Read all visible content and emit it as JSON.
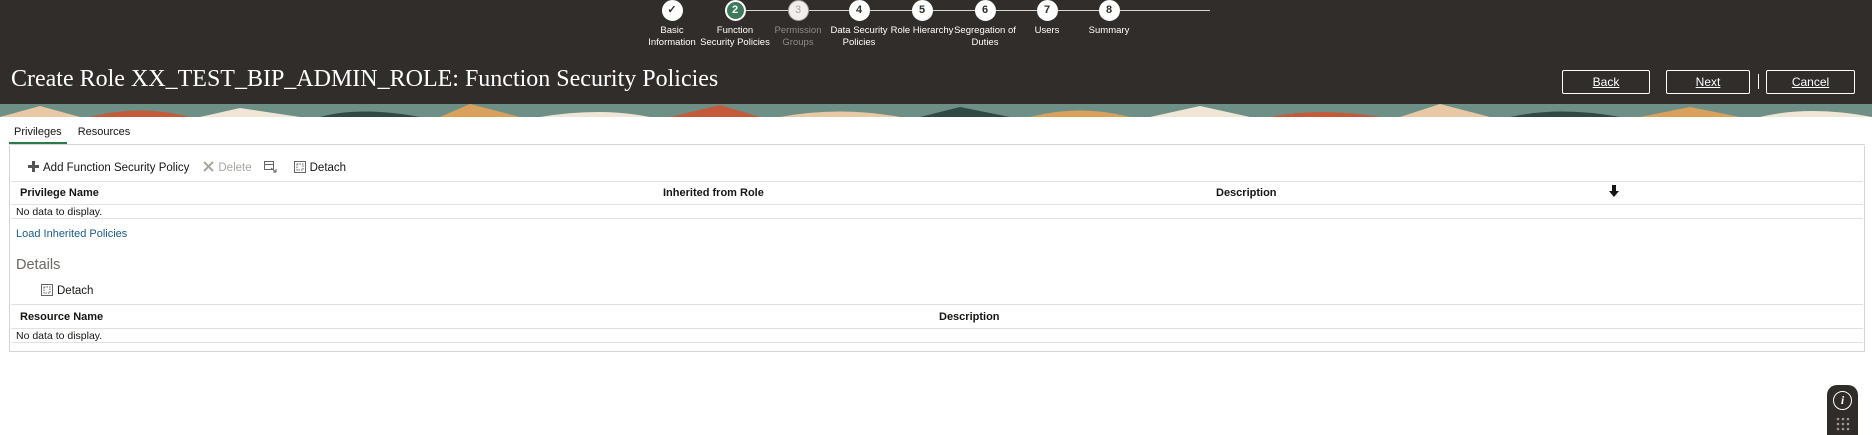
{
  "train": {
    "steps": [
      {
        "number": "✓",
        "label_line1": "Basic",
        "label_line2": "Information",
        "state": "done"
      },
      {
        "number": "2",
        "label_line1": "Function",
        "label_line2": "Security Policies",
        "state": "current"
      },
      {
        "number": "3",
        "label_line1": "Permission",
        "label_line2": "Groups",
        "state": "disabled"
      },
      {
        "number": "4",
        "label_line1": "Data Security",
        "label_line2": "Policies",
        "state": "normal"
      },
      {
        "number": "5",
        "label_line1": "Role Hierarchy",
        "label_line2": "",
        "state": "normal"
      },
      {
        "number": "6",
        "label_line1": "Segregation of",
        "label_line2": "Duties",
        "state": "normal"
      },
      {
        "number": "7",
        "label_line1": "Users",
        "label_line2": "",
        "state": "normal"
      },
      {
        "number": "8",
        "label_line1": "Summary",
        "label_line2": "",
        "state": "normal"
      }
    ]
  },
  "header": {
    "title": "Create Role XX_TEST_BIP_ADMIN_ROLE: Function Security Policies",
    "back_label": "Back",
    "next_label": "Next",
    "cancel_label": "Cancel"
  },
  "tabs": [
    {
      "label": "Privileges",
      "active": true
    },
    {
      "label": "Resources",
      "active": false
    }
  ],
  "toolbar": {
    "add_label": "Add Function Security Policy",
    "delete_label": "Delete",
    "detach_label": "Detach"
  },
  "privileges_table": {
    "columns": [
      "Privilege Name",
      "Inherited from Role",
      "Description"
    ],
    "empty_text": "No data to display."
  },
  "load_inherited_label": "Load Inherited Policies",
  "details": {
    "heading": "Details",
    "detach_label": "Detach",
    "columns": [
      "Resource Name",
      "Description"
    ],
    "empty_text": "No data to display."
  },
  "colors": {
    "header_bg": "#312d2a",
    "current_step": "#3f7b5b",
    "tab_underline": "#2b7a4b",
    "link": "#1a5b8a"
  },
  "icons": {
    "step_done": "checkmark-icon",
    "add": "plus-icon",
    "delete": "x-icon",
    "freeze": "freeze-columns-icon",
    "detach": "detach-icon",
    "sort": "sort-down-icon",
    "help": "info-icon"
  }
}
